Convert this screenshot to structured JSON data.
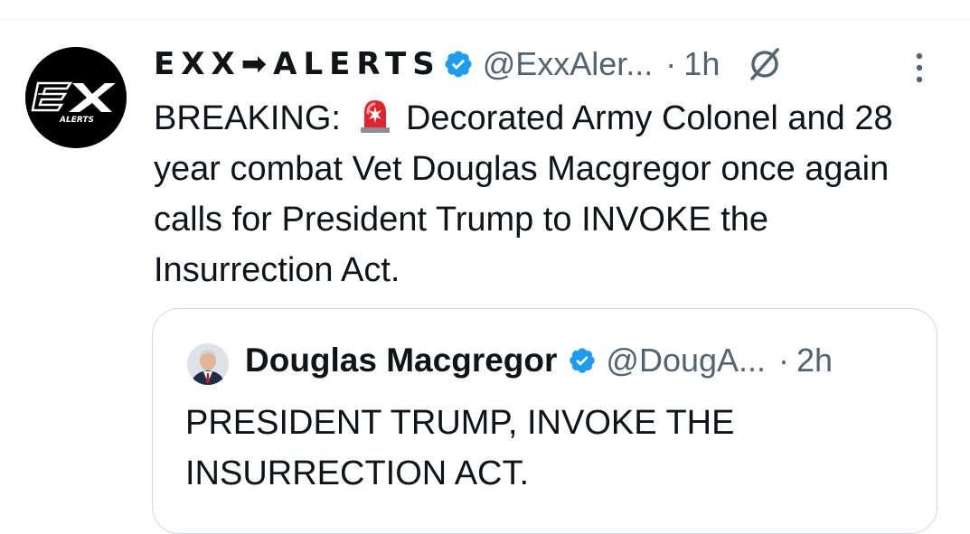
{
  "tweet": {
    "display_name": "EXX➡ALERTS",
    "handle": "@ExxAler...",
    "separator": "·",
    "time": "1h",
    "text_prefix": "BREAKING:",
    "text_body": "Decorated Army Colonel and 28 year combat Vet Douglas Macgregor once again calls for President Trump to INVOKE the Insurrection Act.",
    "avatar_logo_text": "ALERTS"
  },
  "quoted_tweet": {
    "display_name": "Douglas Macgregor",
    "handle": "@DougA...",
    "separator": "·",
    "time": "2h",
    "text": "PRESIDENT TRUMP, INVOKE THE INSURRECTION ACT."
  },
  "icons": {
    "verified": "verified-badge-icon",
    "siren": "police-siren-emoji",
    "grok": "grok-icon",
    "more": "more-options-icon"
  },
  "colors": {
    "verified_blue": "#1d9bf0",
    "secondary_text": "#536471",
    "primary_text": "#0f1419",
    "border": "#cfd9de"
  }
}
